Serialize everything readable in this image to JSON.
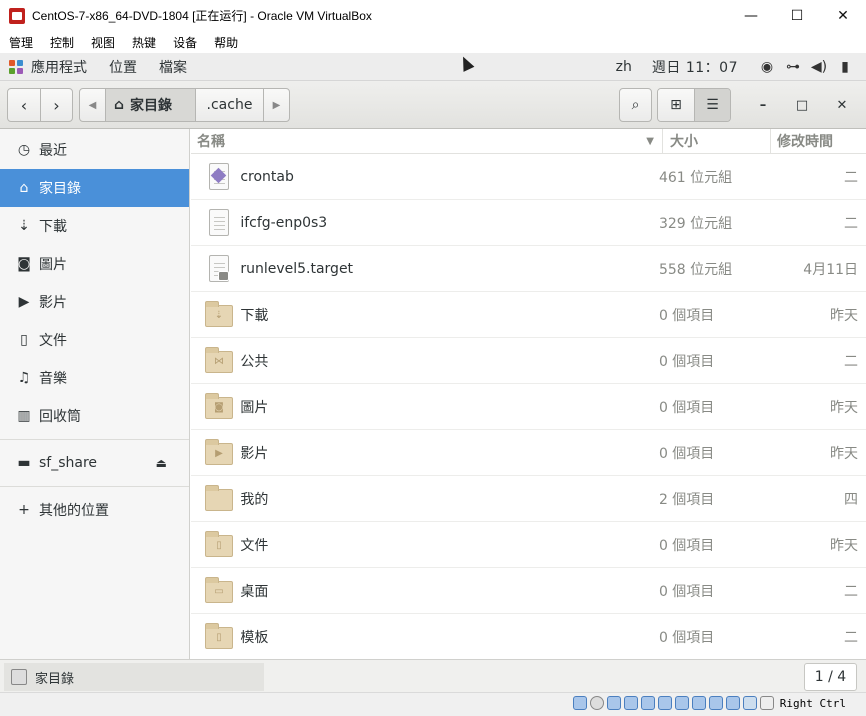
{
  "window": {
    "title": "CentOS-7-x86_64-DVD-1804 [正在运行] - Oracle VM VirtualBox",
    "minimize": "—",
    "maximize": "☐",
    "close": "✕"
  },
  "vbox_menu": [
    "管理",
    "控制",
    "视图",
    "热键",
    "设备",
    "帮助"
  ],
  "gnome_bar": {
    "apps": "應用程式",
    "places": "位置",
    "files": "檔案",
    "lang": "zh",
    "clock": "週日 11：07"
  },
  "header": {
    "back": "‹",
    "forward": "›",
    "path_home": "家目錄",
    "path_cache": ".cache",
    "search": "⌕",
    "grid": "⊞",
    "list": "☰",
    "minimize": "–",
    "maximize": "□",
    "close": "✕"
  },
  "sidebar": {
    "items": [
      {
        "label": "最近",
        "icon": "clock-icon",
        "glyph": "◷"
      },
      {
        "label": "家目錄",
        "icon": "home-icon",
        "glyph": "⌂"
      },
      {
        "label": "下載",
        "icon": "download-icon",
        "glyph": "⇣"
      },
      {
        "label": "圖片",
        "icon": "camera-icon",
        "glyph": "◙"
      },
      {
        "label": "影片",
        "icon": "video-icon",
        "glyph": "▶"
      },
      {
        "label": "文件",
        "icon": "document-icon",
        "glyph": "▯"
      },
      {
        "label": "音樂",
        "icon": "music-icon",
        "glyph": "♫"
      },
      {
        "label": "回收筒",
        "icon": "trash-icon",
        "glyph": "▥"
      }
    ],
    "share": {
      "label": "sf_share",
      "icon": "drive-icon",
      "eject": "⏏"
    },
    "other": {
      "label": "其他的位置",
      "icon": "plus-icon",
      "glyph": "+"
    }
  },
  "columns": {
    "name": "名稱",
    "size": "大小",
    "modified": "修改時間"
  },
  "files": [
    {
      "name": "crontab",
      "size": "461 位元組",
      "modified": "二",
      "type": "file-diamond"
    },
    {
      "name": "ifcfg-enp0s3",
      "size": "329 位元組",
      "modified": "二",
      "type": "file-text"
    },
    {
      "name": "runlevel5.target",
      "size": "558 位元組",
      "modified": "4月11日",
      "type": "file-locked"
    },
    {
      "name": "下載",
      "size": "0 個項目",
      "modified": "昨天",
      "type": "folder",
      "emblem": "⇣"
    },
    {
      "name": "公共",
      "size": "0 個項目",
      "modified": "二",
      "type": "folder",
      "emblem": "⋈"
    },
    {
      "name": "圖片",
      "size": "0 個項目",
      "modified": "昨天",
      "type": "folder",
      "emblem": "◙"
    },
    {
      "name": "影片",
      "size": "0 個項目",
      "modified": "昨天",
      "type": "folder",
      "emblem": "▶"
    },
    {
      "name": "我的",
      "size": "2 個項目",
      "modified": "四",
      "type": "folder",
      "emblem": ""
    },
    {
      "name": "文件",
      "size": "0 個項目",
      "modified": "昨天",
      "type": "folder",
      "emblem": "▯"
    },
    {
      "name": "桌面",
      "size": "0 個項目",
      "modified": "二",
      "type": "folder",
      "emblem": "▭"
    },
    {
      "name": "模板",
      "size": "0 個項目",
      "modified": "二",
      "type": "folder",
      "emblem": "▯"
    }
  ],
  "status": {
    "location": "家目錄",
    "workspace": "1 / 4"
  },
  "vbox_status": {
    "host_key": "Right Ctrl"
  }
}
